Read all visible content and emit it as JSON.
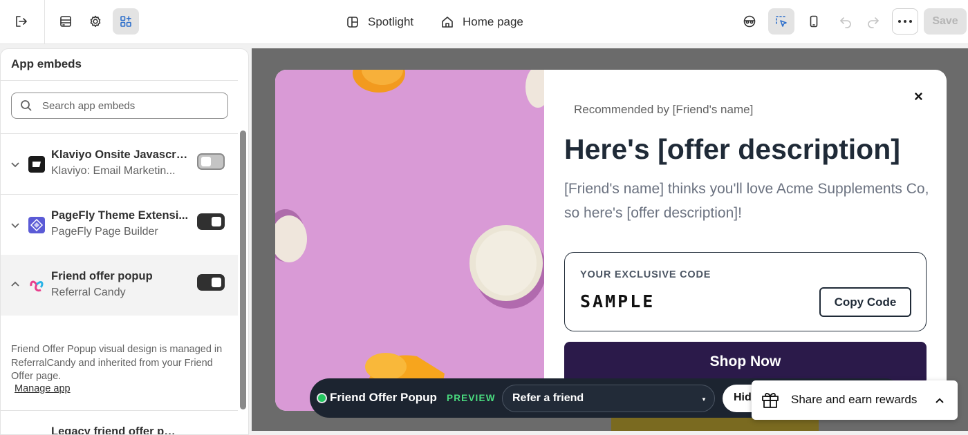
{
  "topbar": {
    "spotlight_label": "Spotlight",
    "page_label": "Home page",
    "save_label": "Save"
  },
  "panel": {
    "title": "App embeds",
    "search_placeholder": "Search app embeds",
    "apps": [
      {
        "name": "Klaviyo Onsite Javascript",
        "subtitle": "Klaviyo: Email Marketin...",
        "enabled": false,
        "expanded": false,
        "logo_color": "#1a1a1a"
      },
      {
        "name": "PageFly Theme Extensi...",
        "subtitle": "PageFly Page Builder",
        "enabled": true,
        "expanded": false,
        "logo_color": "#5b5bd6"
      },
      {
        "name": "Friend offer popup",
        "subtitle": "Referral Candy",
        "enabled": true,
        "expanded": true,
        "logo_color": "#e83e8c"
      }
    ],
    "description": "Friend Offer Popup visual design is managed in ReferralCandy and inherited from your Friend Offer page.",
    "manage_link": "Manage app",
    "next_app_name": "Legacy friend offer pop..."
  },
  "popup": {
    "recommended": "Recommended by [Friend's name]",
    "headline": "Here's [offer description]",
    "subtext": "[Friend's name] thinks you'll love Acme Supplements Co, so here's [offer description]!",
    "code_label": "YOUR EXCLUSIVE CODE",
    "code_value": "SAMPLE",
    "copy_button": "Copy Code",
    "shop_button": "Shop Now",
    "close_symbol": "×"
  },
  "preview_bar": {
    "title": "Friend Offer Popup",
    "tag": "PREVIEW",
    "select_value": "Refer a friend",
    "hide_label": "Hid"
  },
  "share_widget": {
    "label": "Share and earn rewards"
  },
  "colors": {
    "accent_blue": "#2c6ecb",
    "shop_button": "#2b1a4a",
    "preview_tag": "#4ade80",
    "image_bg": "#d99ad6"
  }
}
